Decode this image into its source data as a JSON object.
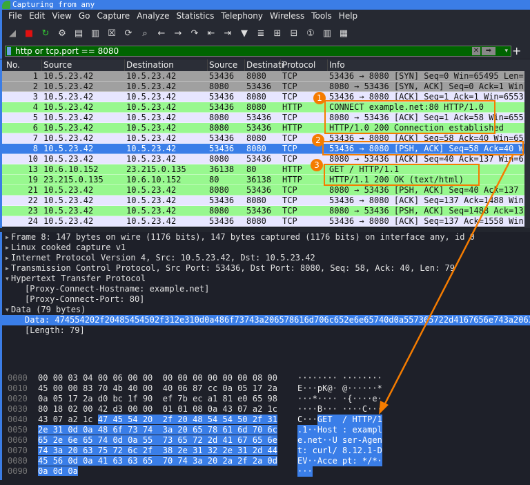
{
  "window": {
    "title": "Capturing from any"
  },
  "menu": [
    "File",
    "Edit",
    "View",
    "Go",
    "Capture",
    "Analyze",
    "Statistics",
    "Telephony",
    "Wireless",
    "Tools",
    "Help"
  ],
  "toolbar": {
    "icons": [
      "shark-fin-start-icon",
      "stop-icon",
      "restart-icon",
      "options-gear-icon",
      "open-file-icon",
      "save-file-icon",
      "close-file-icon",
      "reload-icon",
      "find-icon",
      "back-icon",
      "forward-icon",
      "go-to-packet-icon",
      "first-packet-icon",
      "last-packet-icon",
      "autoscroll-icon",
      "colorize-icon",
      "zoom-in-icon",
      "zoom-out-icon",
      "normal-size-icon",
      "resize-columns-icon",
      "layout-icon"
    ]
  },
  "filter": {
    "value": "http or tcp.port == 8080"
  },
  "packet_list": {
    "columns": [
      "No.",
      "Source",
      "Destination",
      "Source Po",
      "Destinati",
      "Protocol",
      "Info"
    ],
    "colors": {
      "gray": "#a0a0a0",
      "tcp": "#e7e6ff",
      "http": "#98f88f",
      "selected": "#3a7ee8"
    },
    "rows": [
      {
        "no": "1",
        "src": "10.5.23.42",
        "dst": "10.5.23.42",
        "sport": "53436",
        "dport": "8080",
        "proto": "TCP",
        "info": "53436 → 8080 [SYN] Seq=0 Win=65495 Len=",
        "color": "gray"
      },
      {
        "no": "2",
        "src": "10.5.23.42",
        "dst": "10.5.23.42",
        "sport": "8080",
        "dport": "53436",
        "proto": "TCP",
        "info": "8080 → 53436 [SYN, ACK] Seq=0 Ack=1 Win",
        "color": "gray"
      },
      {
        "no": "3",
        "src": "10.5.23.42",
        "dst": "10.5.23.42",
        "sport": "53436",
        "dport": "8080",
        "proto": "TCP",
        "info": "53436 → 8080 [ACK] Seq=1 Ack=1 Win=6553",
        "color": "tcp"
      },
      {
        "no": "4",
        "src": "10.5.23.42",
        "dst": "10.5.23.42",
        "sport": "53436",
        "dport": "8080",
        "proto": "HTTP",
        "info": "CONNECT example.net:80 HTTP/1.0",
        "color": "http"
      },
      {
        "no": "5",
        "src": "10.5.23.42",
        "dst": "10.5.23.42",
        "sport": "8080",
        "dport": "53436",
        "proto": "TCP",
        "info": "8080 → 53436 [ACK] Seq=1 Ack=58 Win=655",
        "color": "tcp"
      },
      {
        "no": "6",
        "src": "10.5.23.42",
        "dst": "10.5.23.42",
        "sport": "8080",
        "dport": "53436",
        "proto": "HTTP",
        "info": "HTTP/1.0 200 Connection established",
        "color": "http"
      },
      {
        "no": "7",
        "src": "10.5.23.42",
        "dst": "10.5.23.42",
        "sport": "53436",
        "dport": "8080",
        "proto": "TCP",
        "info": "53436 → 8080 [ACK] Seq=58 Ack=40 Win=65",
        "color": "tcp"
      },
      {
        "no": "8",
        "src": "10.5.23.42",
        "dst": "10.5.23.42",
        "sport": "53436",
        "dport": "8080",
        "proto": "TCP",
        "info": "53436 → 8080 [PSH, ACK] Seq=58 Ack=40 W",
        "color": "selected"
      },
      {
        "no": "10",
        "src": "10.5.23.42",
        "dst": "10.5.23.42",
        "sport": "8080",
        "dport": "53436",
        "proto": "TCP",
        "info": "8080 → 53436 [ACK] Seq=40 Ack=137 Win=6",
        "color": "tcp"
      },
      {
        "no": "13",
        "src": "10.6.10.152",
        "dst": "23.215.0.135",
        "sport": "36138",
        "dport": "80",
        "proto": "HTTP",
        "info": "GET / HTTP/1.1",
        "color": "http"
      },
      {
        "no": "19",
        "src": "23.215.0.135",
        "dst": "10.6.10.152",
        "sport": "80",
        "dport": "36138",
        "proto": "HTTP",
        "info": "HTTP/1.1 200 OK  (text/html)",
        "color": "http"
      },
      {
        "no": "21",
        "src": "10.5.23.42",
        "dst": "10.5.23.42",
        "sport": "8080",
        "dport": "53436",
        "proto": "TCP",
        "info": "8080 → 53436 [PSH, ACK] Seq=40 Ack=137",
        "color": "http"
      },
      {
        "no": "22",
        "src": "10.5.23.42",
        "dst": "10.5.23.42",
        "sport": "53436",
        "dport": "8080",
        "proto": "TCP",
        "info": "53436 → 8080 [ACK] Seq=137 Ack=1488 Win",
        "color": "tcp"
      },
      {
        "no": "23",
        "src": "10.5.23.42",
        "dst": "10.5.23.42",
        "sport": "8080",
        "dport": "53436",
        "proto": "TCP",
        "info": "8080 → 53436 [PSH, ACK] Seq=1488 Ack=13",
        "color": "http"
      },
      {
        "no": "24",
        "src": "10.5.23.42",
        "dst": "10.5.23.42",
        "sport": "53436",
        "dport": "8080",
        "proto": "TCP",
        "info": "53436 → 8080 [ACK] Seq=137 Ack=1558 Win",
        "color": "tcp"
      }
    ]
  },
  "details": [
    {
      "text": "Frame 8: 147 bytes on wire (1176 bits), 147 bytes captured (1176 bits) on interface any, id 0",
      "state": "collapsed",
      "indent": 0
    },
    {
      "text": "Linux cooked capture v1",
      "state": "collapsed",
      "indent": 0
    },
    {
      "text": "Internet Protocol Version 4, Src: 10.5.23.42, Dst: 10.5.23.42",
      "state": "collapsed",
      "indent": 0
    },
    {
      "text": "Transmission Control Protocol, Src Port: 53436, Dst Port: 8080, Seq: 58, Ack: 40, Len: 79",
      "state": "collapsed",
      "indent": 0
    },
    {
      "text": "Hypertext Transfer Protocol",
      "state": "expanded",
      "indent": 0
    },
    {
      "text": "[Proxy-Connect-Hostname: example.net]",
      "state": "leaf",
      "indent": 1
    },
    {
      "text": "[Proxy-Connect-Port: 80]",
      "state": "leaf",
      "indent": 1
    },
    {
      "text": "Data (79 bytes)",
      "state": "expanded",
      "indent": 0
    },
    {
      "text": "Data: 474554202f20485454502f312e310d0a486f73743a206578616d706c652e6e65740d0a557365722d4167656e743a2063",
      "state": "leaf",
      "indent": 1,
      "selected": true
    },
    {
      "text": "[Length: 79]",
      "state": "leaf",
      "indent": 1
    }
  ],
  "hex": [
    {
      "off": "0000",
      "bytes": [
        "00",
        "00",
        "03",
        "04",
        "00",
        "06",
        "00",
        "00",
        "00",
        "00",
        "00",
        "00",
        "00",
        "00",
        "08",
        "00"
      ],
      "ascii": "········ ········"
    },
    {
      "off": "0010",
      "bytes": [
        "45",
        "00",
        "00",
        "83",
        "70",
        "4b",
        "40",
        "00",
        "40",
        "06",
        "87",
        "cc",
        "0a",
        "05",
        "17",
        "2a"
      ],
      "ascii": "E···pK@· @······*"
    },
    {
      "off": "0020",
      "bytes": [
        "0a",
        "05",
        "17",
        "2a",
        "d0",
        "bc",
        "1f",
        "90",
        "ef",
        "7b",
        "ec",
        "a1",
        "81",
        "e0",
        "65",
        "98"
      ],
      "ascii": "···*···· ·{····e·"
    },
    {
      "off": "0030",
      "bytes": [
        "80",
        "18",
        "02",
        "00",
        "42",
        "d3",
        "00",
        "00",
        "01",
        "01",
        "08",
        "0a",
        "43",
        "07",
        "a2",
        "1c"
      ],
      "ascii": "····B··· ····C···"
    },
    {
      "off": "0040",
      "bytes": [
        "43",
        "07",
        "a2",
        "1c",
        "47",
        "45",
        "54",
        "20",
        "2f",
        "20",
        "48",
        "54",
        "54",
        "50",
        "2f",
        "31"
      ],
      "ascii": "C···GET  / HTTP/1"
    },
    {
      "off": "0050",
      "bytes": [
        "2e",
        "31",
        "0d",
        "0a",
        "48",
        "6f",
        "73",
        "74",
        "3a",
        "20",
        "65",
        "78",
        "61",
        "6d",
        "70",
        "6c"
      ],
      "ascii": ".1··Host : exampl"
    },
    {
      "off": "0060",
      "bytes": [
        "65",
        "2e",
        "6e",
        "65",
        "74",
        "0d",
        "0a",
        "55",
        "73",
        "65",
        "72",
        "2d",
        "41",
        "67",
        "65",
        "6e"
      ],
      "ascii": "e.net··U ser-Agen"
    },
    {
      "off": "0070",
      "bytes": [
        "74",
        "3a",
        "20",
        "63",
        "75",
        "72",
        "6c",
        "2f",
        "38",
        "2e",
        "31",
        "32",
        "2e",
        "31",
        "2d",
        "44"
      ],
      "ascii": "t: curl/ 8.12.1-D"
    },
    {
      "off": "0080",
      "bytes": [
        "45",
        "56",
        "0d",
        "0a",
        "41",
        "63",
        "63",
        "65",
        "70",
        "74",
        "3a",
        "20",
        "2a",
        "2f",
        "2a",
        "0d"
      ],
      "ascii": "EV··Acce pt: */*·"
    },
    {
      "off": "0090",
      "bytes": [
        "0a",
        "0d",
        "0a"
      ],
      "ascii": "···"
    }
  ],
  "hex_highlight_start": 68,
  "annotations": {
    "color": "#f57c00",
    "labels": [
      "1",
      "2",
      "3"
    ]
  }
}
